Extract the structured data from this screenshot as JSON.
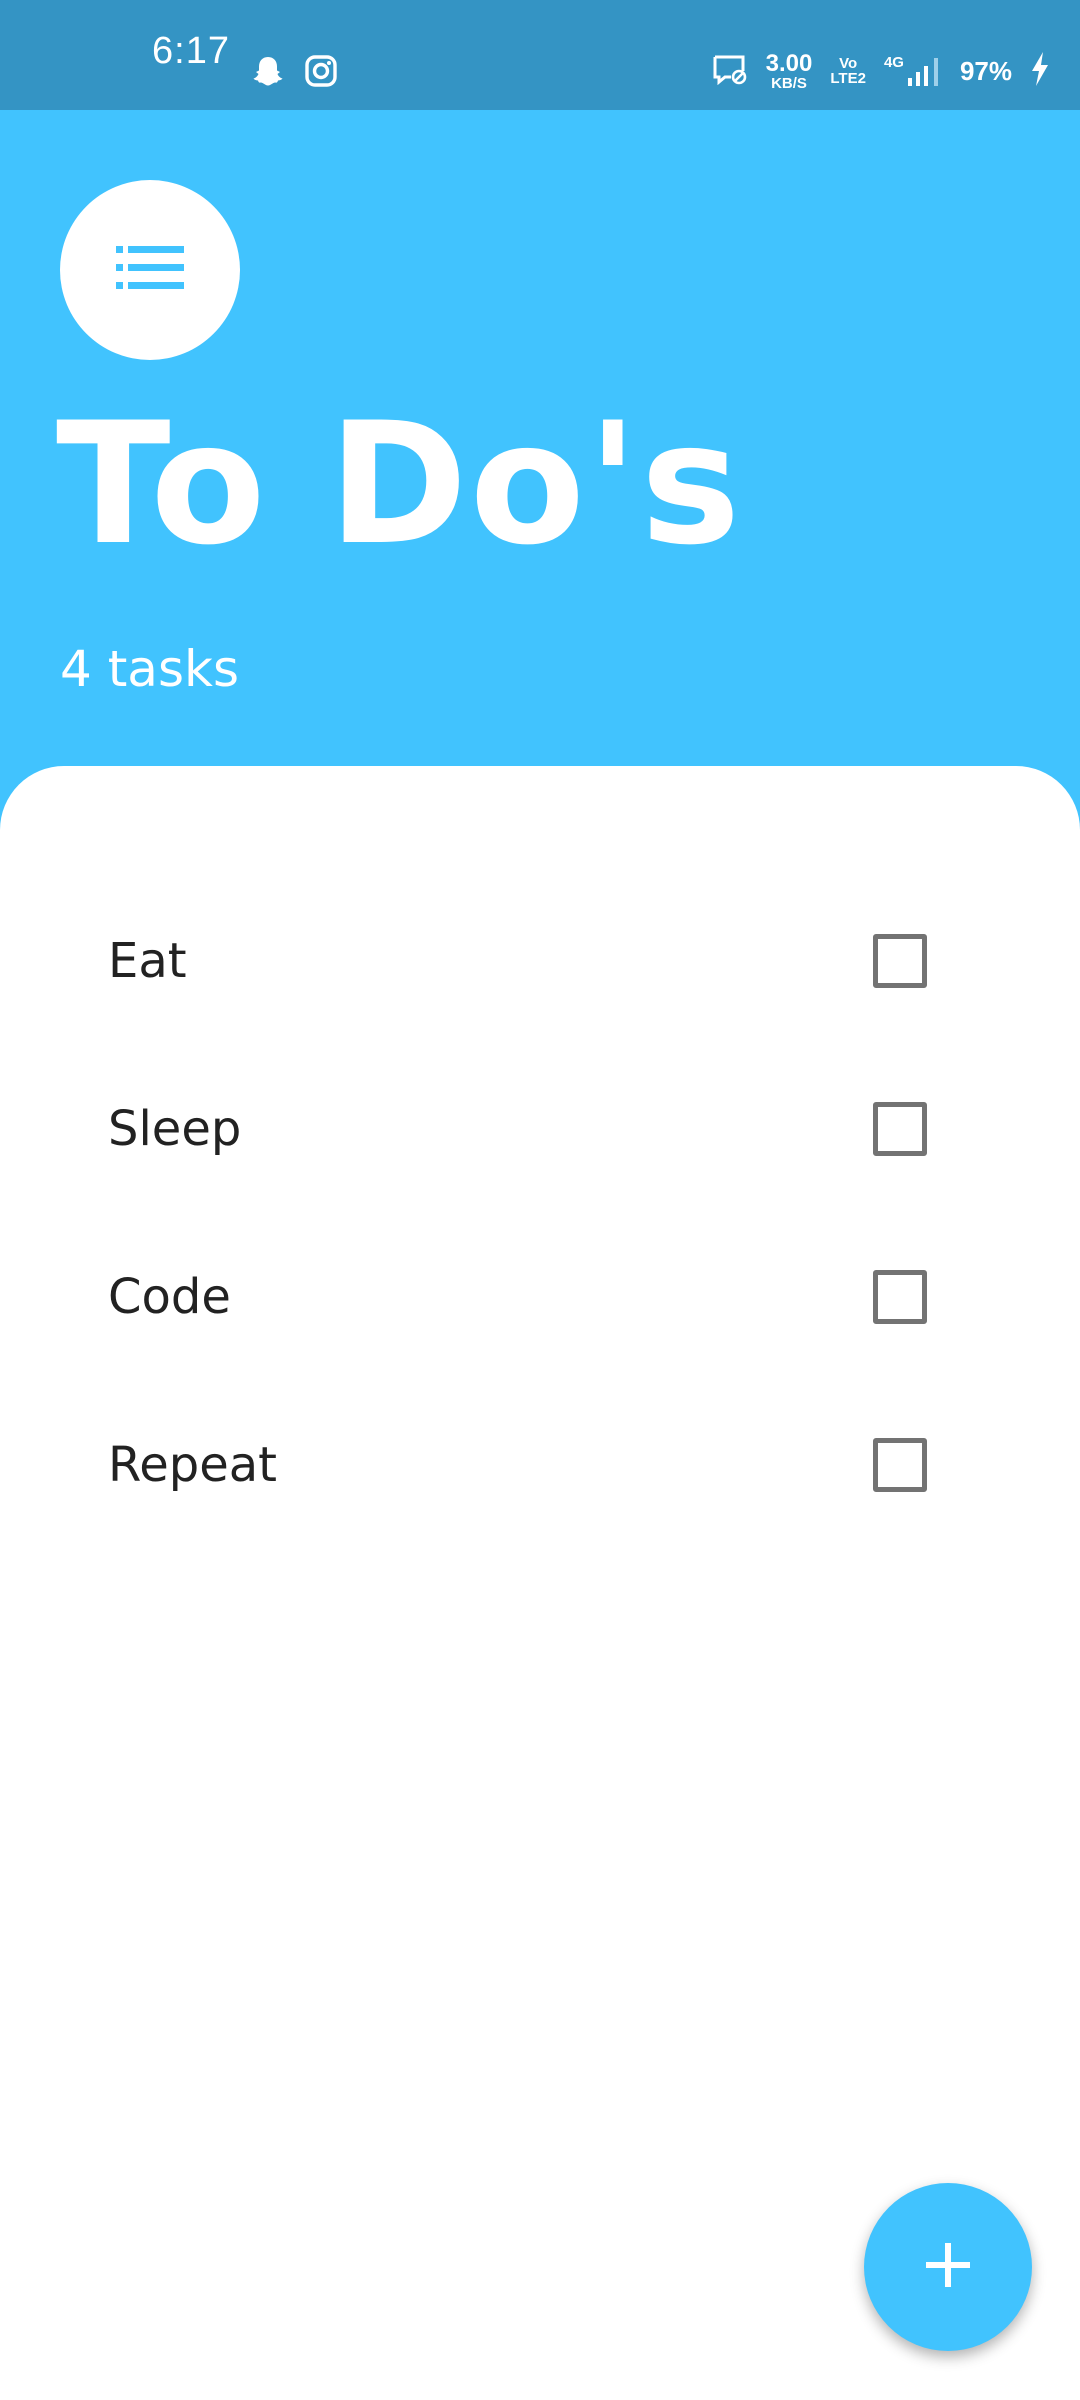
{
  "status_bar": {
    "time": "6:17",
    "net_speed_value": "3.00",
    "net_speed_unit": "KB/S",
    "volte_top": "Vo",
    "volte_bottom": "LTE2",
    "network": "4G",
    "battery": "97%",
    "icons": [
      "snapchat-icon",
      "instagram-icon",
      "data-saver-icon",
      "signal-icon",
      "charging-icon"
    ]
  },
  "header": {
    "menu_icon": "list-icon",
    "title": "To Do's",
    "subtitle": "4 tasks"
  },
  "tasks": [
    {
      "label": "Eat",
      "checked": false
    },
    {
      "label": "Sleep",
      "checked": false
    },
    {
      "label": "Code",
      "checked": false
    },
    {
      "label": "Repeat",
      "checked": false
    }
  ],
  "fab": {
    "icon": "plus-icon"
  },
  "colors": {
    "accent": "#41c3fe",
    "status_bar": "#3494c4",
    "text": "#222222",
    "checkbox": "#737373"
  }
}
